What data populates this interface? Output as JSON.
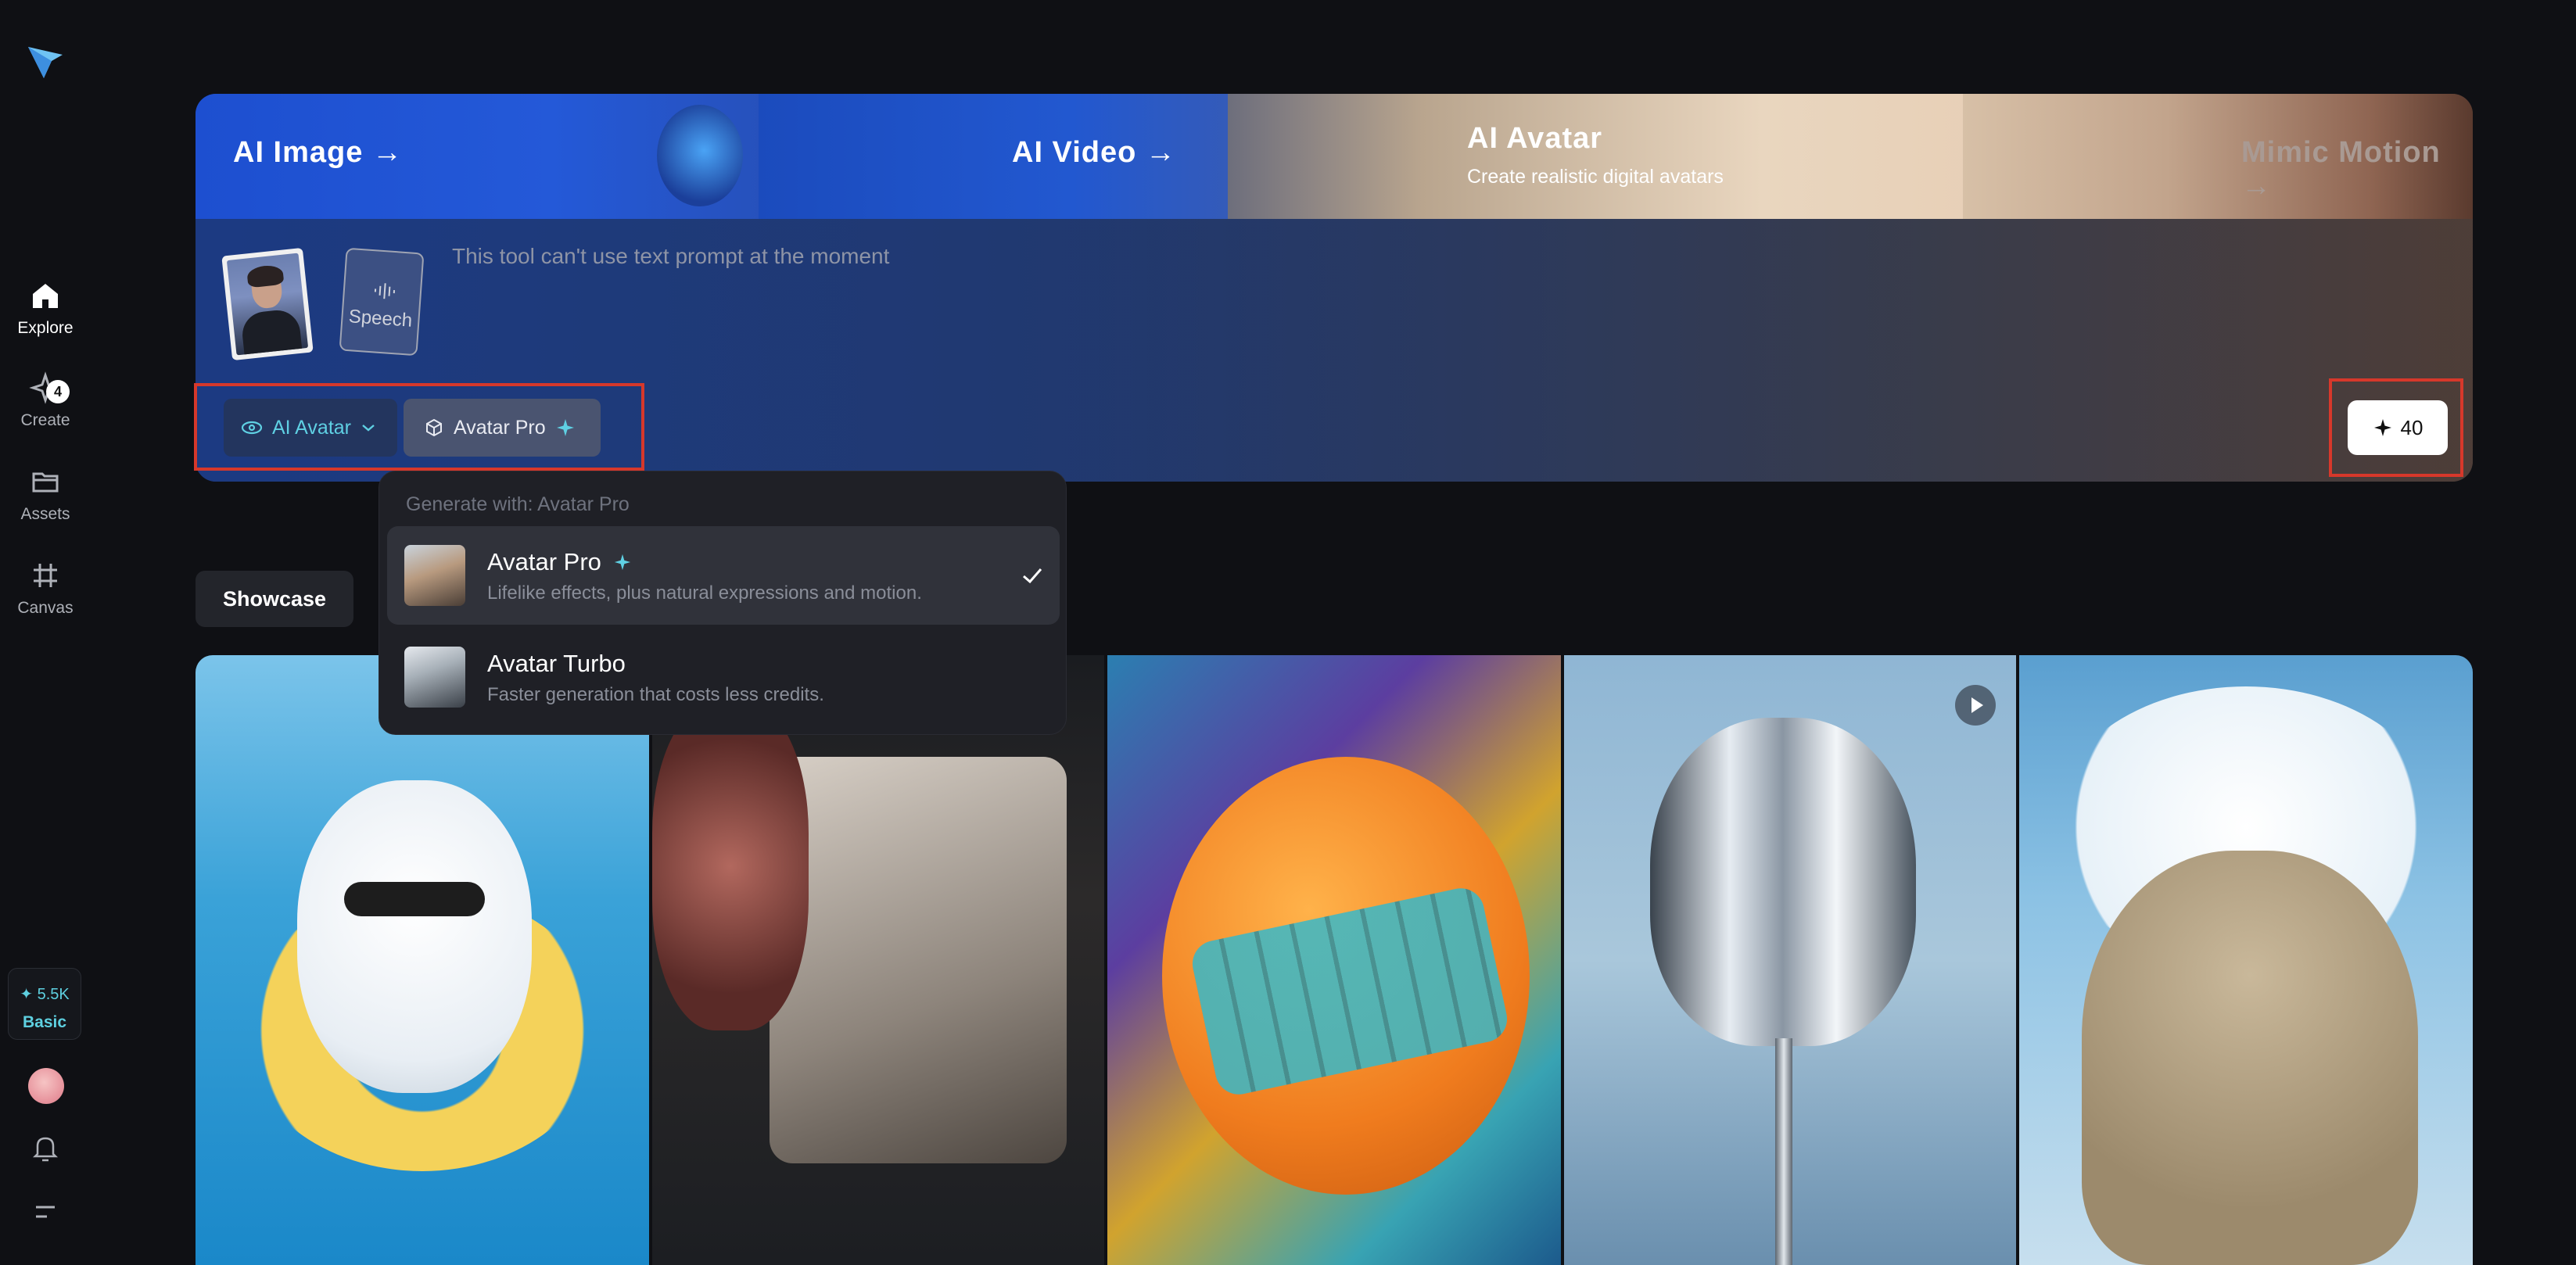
{
  "sidebar": {
    "items": [
      {
        "label": "Explore",
        "icon": "home-icon"
      },
      {
        "label": "Create",
        "icon": "sparkle-create-icon",
        "badge": "4"
      },
      {
        "label": "Assets",
        "icon": "folder-icon"
      },
      {
        "label": "Canvas",
        "icon": "canvas-grid-icon"
      }
    ],
    "credits": {
      "value": "✦ 5.5K",
      "plan": "Basic"
    }
  },
  "banner": {
    "tabs": [
      {
        "label": "AI Image →"
      },
      {
        "label": "AI Video →"
      },
      {
        "label": "AI Avatar",
        "subtitle": "Create realistic digital avatars"
      },
      {
        "label": "Mimic Motion →"
      }
    ]
  },
  "prompt": {
    "placeholder": "This tool can't use text prompt at the moment",
    "speech_label": "Speech"
  },
  "controls": {
    "mode_label": "AI Avatar",
    "model_label": "Avatar Pro",
    "generate_cost": "40"
  },
  "dropdown": {
    "heading": "Generate with: Avatar Pro",
    "items": [
      {
        "title": "Avatar Pro",
        "desc": "Lifelike effects, plus natural expressions and motion.",
        "selected": true
      },
      {
        "title": "Avatar Turbo",
        "desc": "Faster generation that costs less credits.",
        "selected": false
      }
    ]
  },
  "showcase": {
    "label": "Showcase"
  },
  "colors": {
    "accent": "#5ed0e0",
    "highlight_outline": "#d6382b",
    "background": "#0f1014"
  }
}
